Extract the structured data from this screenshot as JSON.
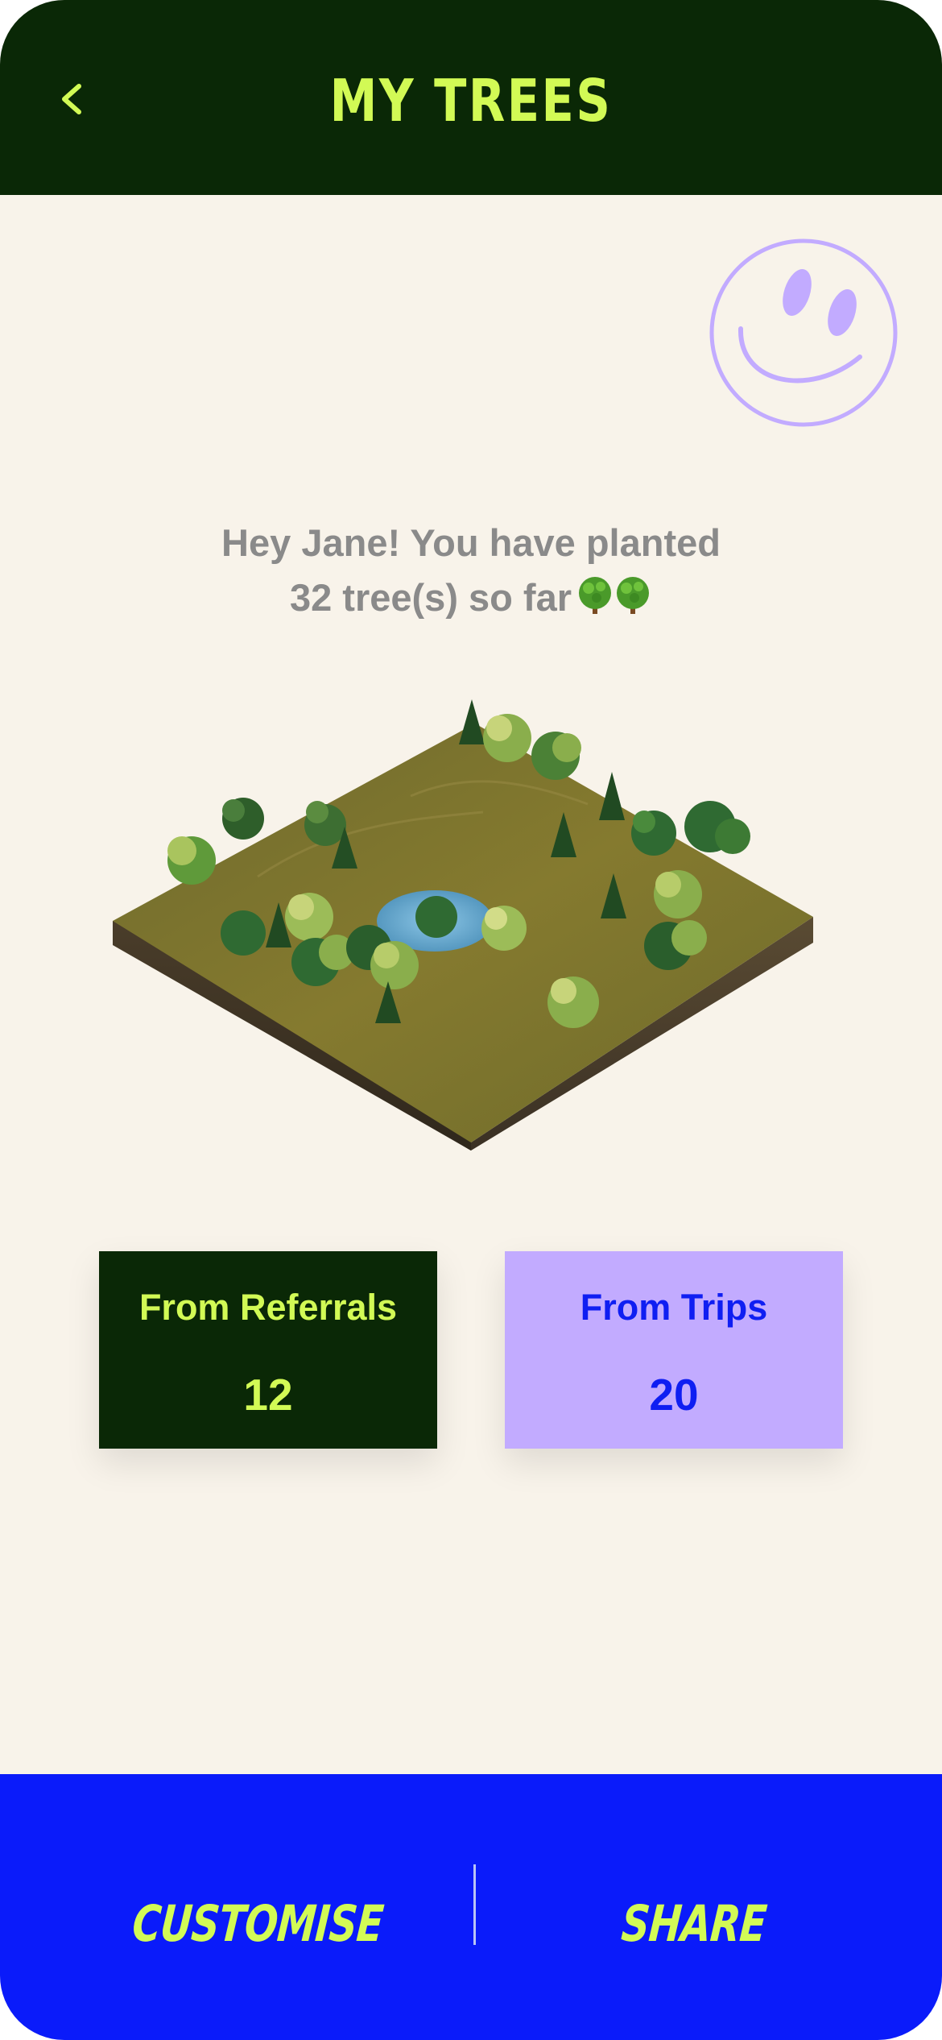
{
  "header": {
    "title": "MY TREES",
    "back_icon": "chevron-left-icon"
  },
  "colors": {
    "header_bg": "#0a2806",
    "accent_lime": "#d2fa55",
    "page_bg": "#f8f3ea",
    "lavender": "#c2abff",
    "blue": "#0a1bfa"
  },
  "message": {
    "line1": "Hey Jane! You have planted",
    "line2": "32 tree(s) so far"
  },
  "stats": [
    {
      "label": "From Referrals",
      "value": "12"
    },
    {
      "label": "From Trips",
      "value": "20"
    }
  ],
  "footer": {
    "customise_label": "CUSTOMISE",
    "share_label": "SHARE"
  }
}
